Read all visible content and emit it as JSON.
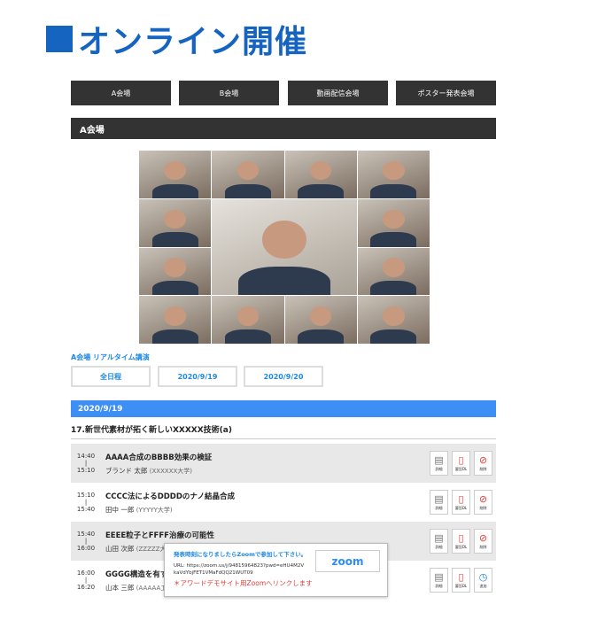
{
  "title": "オンライン開催",
  "venues": [
    "A会場",
    "B会場",
    "動画配信会場",
    "ポスター発表会場"
  ],
  "section": "A会場",
  "realtime_link": "A会場 リアルタイム講演",
  "date_tabs": [
    "全日程",
    "2020/9/19",
    "2020/9/20"
  ],
  "date_bar": "2020/9/19",
  "session_title": "17.新世代素材が拓く新しいXXXXX技術(a)",
  "talks": [
    {
      "start": "14:40",
      "sep": "|",
      "end": "15:10",
      "title": "AAAA合成のBBBB効果の検証",
      "author": "ブランド 太郎",
      "affil": "(XXXXXX大学)",
      "actions": [
        "詳細",
        "要旨DL",
        "削除"
      ],
      "third_icon": "delete-icon"
    },
    {
      "start": "15:10",
      "sep": "|",
      "end": "15:40",
      "title": "CCCC法によるDDDDのナノ結晶合成",
      "author": "田中 一郎",
      "affil": "(YYYYY大学)",
      "actions": [
        "詳細",
        "要旨DL",
        "削除"
      ],
      "third_icon": "delete-icon"
    },
    {
      "start": "15:40",
      "sep": "|",
      "end": "16:00",
      "title": "EEEE粒子とFFFF治療の可能性",
      "author": "山田 次郎",
      "affil": "(ZZZZZ大学)",
      "actions": [
        "詳細",
        "要旨DL",
        "削除"
      ],
      "third_icon": "delete-icon"
    },
    {
      "start": "16:00",
      "sep": "|",
      "end": "16:20",
      "title": "GGGG構造を有する",
      "author": "山本 三郎",
      "affil": "(AAAAA工",
      "actions": [
        "詳細",
        "要旨DL",
        "追加"
      ],
      "third_icon": "clock-add-icon"
    }
  ],
  "popup": {
    "message": "発表時刻になりましたらZoomで参加して下さい。",
    "url": "URL: https://zoom.us/j/94815964823?pwd=eHU4M2VkaVdYbjFET1VMaFdQQ21WUT09",
    "note": "＊アワードデモサイト用Zoomへリンクします",
    "zoom_label": "zoom"
  },
  "colors": {
    "brand": "#1565c0",
    "accent": "#3d8ef5",
    "dark": "#333333",
    "alert": "#e53935"
  }
}
